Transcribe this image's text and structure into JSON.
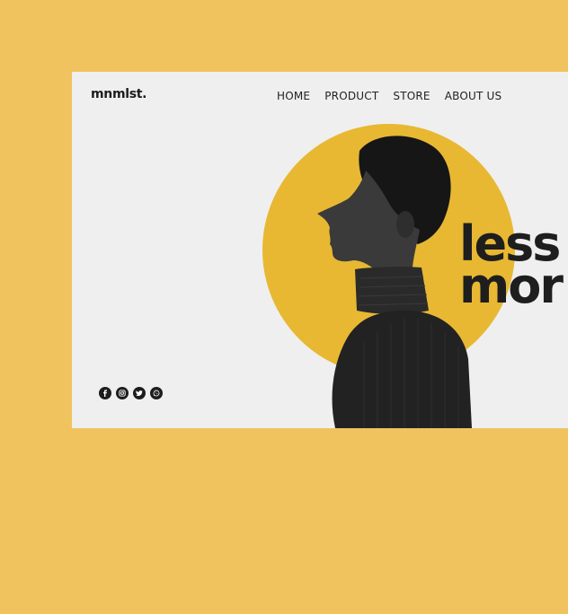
{
  "brand": {
    "logo": "mnmlst."
  },
  "nav": {
    "items": [
      {
        "label": "HOME"
      },
      {
        "label": "PRODUCT"
      },
      {
        "label": "STORE"
      },
      {
        "label": "ABOUT US"
      }
    ]
  },
  "hero": {
    "line1": "less",
    "line2": "mor"
  },
  "socials": [
    {
      "icon": "facebook-icon"
    },
    {
      "icon": "instagram-icon"
    },
    {
      "icon": "twitter-icon"
    },
    {
      "icon": "whatsapp-icon"
    }
  ],
  "colors": {
    "background": "#f0c35f",
    "card": "#efefef",
    "accent_circle": "#e8b833",
    "text": "#1d1d1d"
  }
}
